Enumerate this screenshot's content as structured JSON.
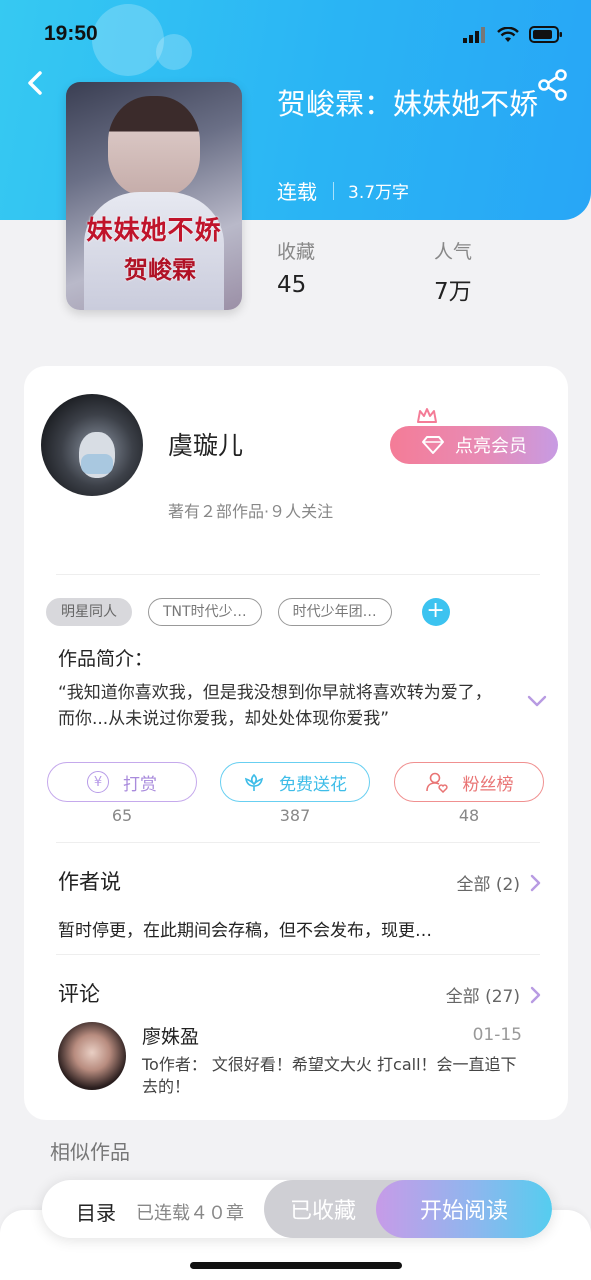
{
  "status_bar": {
    "time": "19:50"
  },
  "book": {
    "cover_title": "妹妹她不娇",
    "cover_author": "贺峻霖",
    "title": "贺峻霖：妹妹她不娇",
    "status": "连载",
    "word_count": "3.7万字",
    "stats": [
      {
        "label": "收藏",
        "value": "45"
      },
      {
        "label": "人气",
        "value": "7万"
      }
    ]
  },
  "author": {
    "name": "虞璇儿",
    "stats": "著有２部作品·９人关注",
    "vip_button": "点亮会员"
  },
  "tags": [
    "明星同人",
    "TNT时代少…",
    "时代少年团…"
  ],
  "tag_add": "+",
  "intro": {
    "label": "作品简介：",
    "text": "“我知道你喜欢我，但是我没想到你早就将喜欢转为爱了，而你...从未说过你爱我，却处处体现你爱我”"
  },
  "actions": [
    {
      "label": "打赏",
      "count": "65",
      "icon": "yen-icon",
      "color": "#b79be8"
    },
    {
      "label": "免费送花",
      "count": "387",
      "icon": "flower-icon",
      "color": "#4cc6ef"
    },
    {
      "label": "粉丝榜",
      "count": "48",
      "icon": "fans-icon",
      "color": "#ee7f7f"
    }
  ],
  "author_says": {
    "title": "作者说",
    "all_label": "全部 (2)",
    "text": "暂时停更，在此期间会存稿，但不会发布，现更…"
  },
  "comments": {
    "title": "评论",
    "all_label": "全部 (27)",
    "items": [
      {
        "user": "廖姝盈",
        "date": "01-15",
        "text": "To作者： 文很好看！希望文大火 打call！会一直追下去的！"
      }
    ]
  },
  "similar_label": "相似作品",
  "bottom_bar": {
    "toc": "目录",
    "chapters": "已连载４０章",
    "collected": "已收藏",
    "read": "开始阅读"
  },
  "colors": {
    "header_start": "#36c9f2",
    "header_end": "#28a6f6",
    "accent_purple": "#c79be3",
    "accent_pink": "#f47c97"
  }
}
